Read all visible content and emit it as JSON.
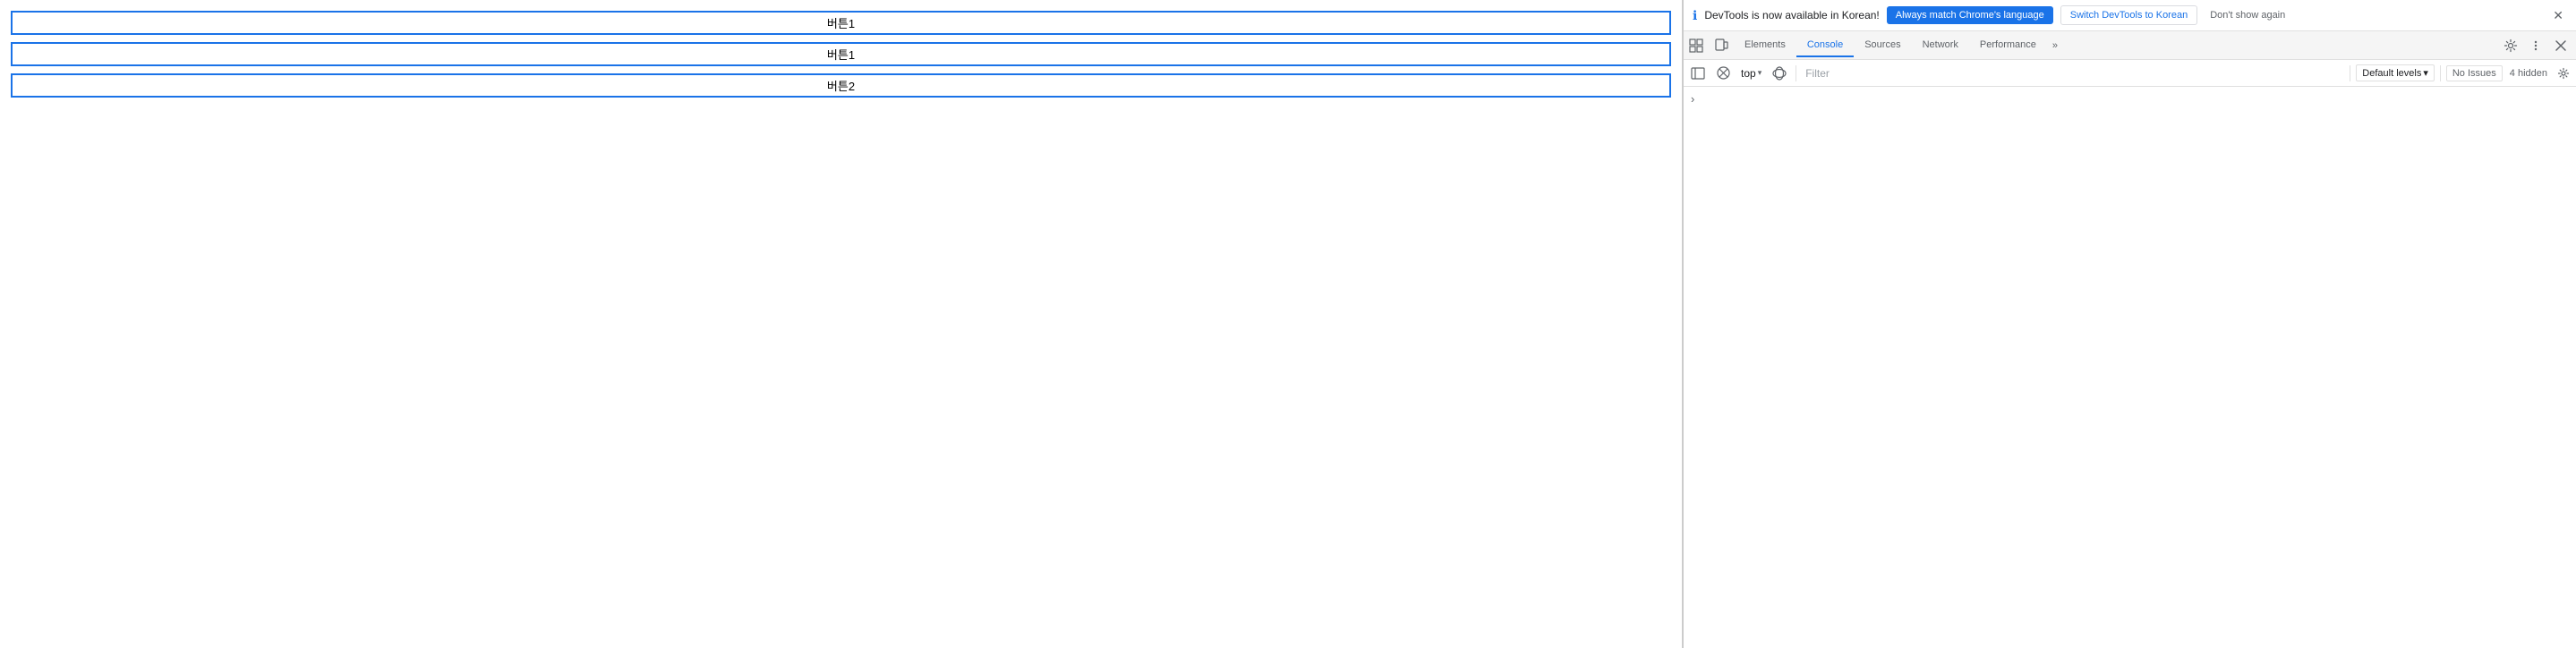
{
  "page": {
    "buttons": [
      {
        "label": "버튼1",
        "id": "btn1a"
      },
      {
        "label": "버튼1",
        "id": "btn1b"
      },
      {
        "label": "버튼2",
        "id": "btn2"
      }
    ]
  },
  "devtools": {
    "notification": {
      "icon": "ℹ",
      "message": "DevTools is now available in Korean!",
      "btn_match_label": "Always match Chrome's language",
      "btn_switch_label": "Switch DevTools to Korean",
      "btn_dont_show_label": "Don't show again",
      "close_label": "✕"
    },
    "tabs": {
      "icon_inspect": "⊞",
      "icon_device": "▭",
      "items": [
        {
          "label": "Elements",
          "active": false
        },
        {
          "label": "Console",
          "active": true
        },
        {
          "label": "Sources",
          "active": false
        },
        {
          "label": "Network",
          "active": false
        },
        {
          "label": "Performance",
          "active": false
        }
      ],
      "more_label": "»",
      "settings_label": "⚙",
      "more_options_label": "⋮",
      "close_label": "✕"
    },
    "console_toolbar": {
      "sidebar_icon": "▤",
      "clear_icon": "⊘",
      "context_label": "top",
      "context_arrow": "▾",
      "eye_icon": "👁",
      "filter_placeholder": "Filter",
      "default_levels_label": "Default levels",
      "default_levels_arrow": "▾",
      "no_issues_label": "No Issues",
      "hidden_count": "4 hidden",
      "settings_icon": "⚙"
    },
    "console_content": {
      "chevron": "›"
    }
  }
}
